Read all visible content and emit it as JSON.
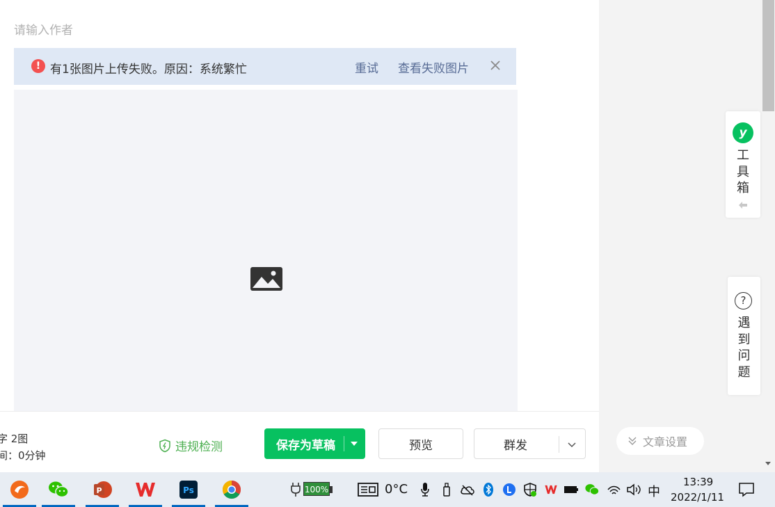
{
  "editor": {
    "author_placeholder": "请输入作者",
    "alert": {
      "message": "有1张图片上传失败。原因：系统繁忙",
      "retry": "重试",
      "view_failed": "查看失败图片"
    }
  },
  "footer": {
    "word_stat": "字 2图",
    "time_stat": "间：",
    "time_value": "0分钟",
    "compliance_check": "违规检测",
    "save_draft": "保存为草稿",
    "preview": "预览",
    "mass_send": "群发"
  },
  "side": {
    "toolbox": [
      "工",
      "具",
      "箱"
    ],
    "help": [
      "遇",
      "到",
      "问",
      "题"
    ],
    "article_settings": "文章设置"
  },
  "taskbar": {
    "battery": "100%",
    "temperature": "0°C",
    "ime": "中",
    "time": "13:39",
    "date": "2022/1/11"
  },
  "colors": {
    "primary_green": "#07c160",
    "link_blue": "#576b95",
    "alert_red": "#f35151",
    "alert_bg": "#dfe8f5"
  }
}
